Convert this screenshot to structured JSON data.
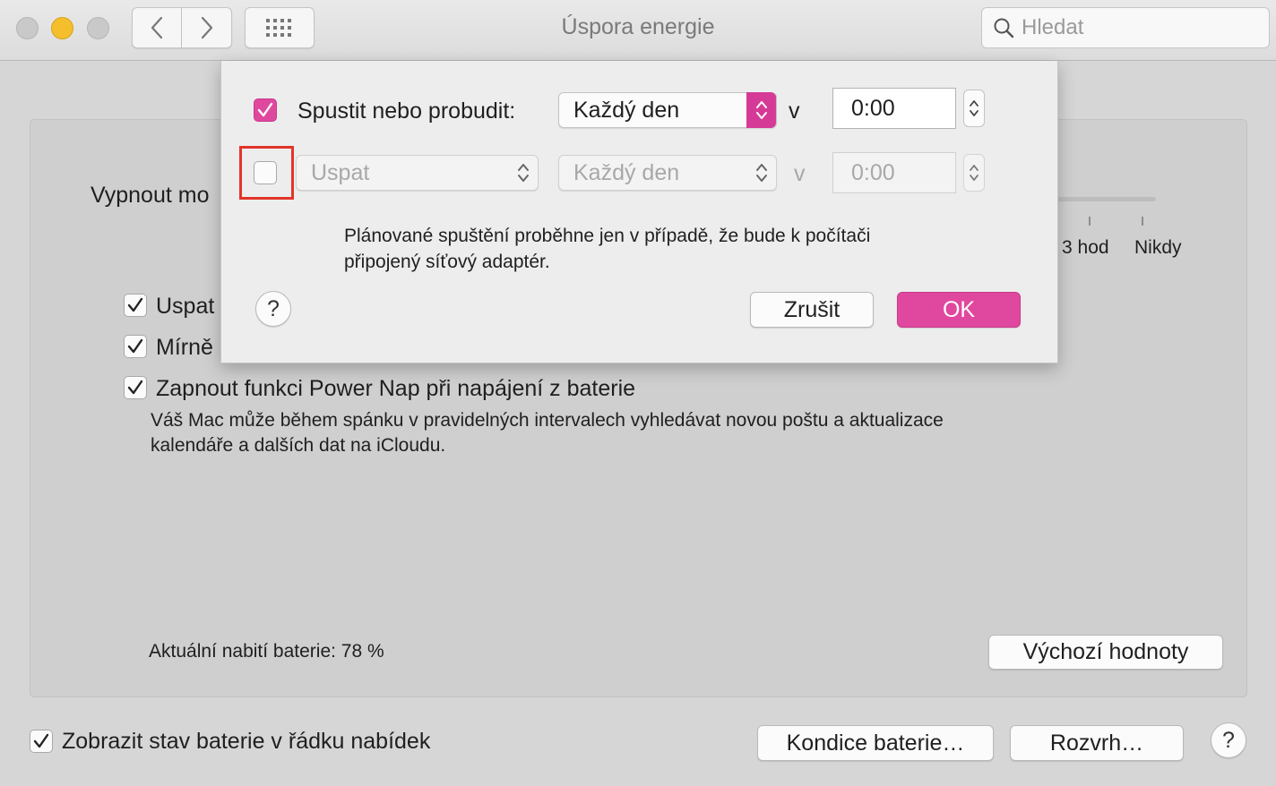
{
  "window": {
    "title": "Úspora energie",
    "search_placeholder": "Hledat"
  },
  "panel": {
    "display_off_label": "Vypnout mo",
    "slider_labels": [
      "3 hod",
      "Nikdy"
    ],
    "checkboxes": [
      {
        "label": "Uspat",
        "checked": true
      },
      {
        "label": "Mírně",
        "checked": true
      },
      {
        "label": "Zapnout funkci Power Nap při napájení z baterie",
        "checked": true
      }
    ],
    "power_nap_description_line1": "Váš Mac může během spánku v pravidelných intervalech vyhledávat novou poštu a aktualizace",
    "power_nap_description_line2": "kalendáře a dalších dat na iCloudu.",
    "battery_charge": "Aktuální nabití baterie: 78 %",
    "defaults_button": "Výchozí hodnoty"
  },
  "footer": {
    "show_battery_label": "Zobrazit stav baterie v řádku nabídek",
    "show_battery_checked": true,
    "battery_health_button": "Kondice baterie…",
    "schedule_button": "Rozvrh…",
    "help": "?"
  },
  "sheet": {
    "row1": {
      "checked": true,
      "label": "Spustit nebo probudit:",
      "frequency": "Každý den",
      "at": "v",
      "time": "0:00"
    },
    "row2": {
      "checked": false,
      "action": "Uspat",
      "frequency": "Každý den",
      "at": "v",
      "time": "0:00"
    },
    "note_line1": "Plánované spuštění proběhne jen v případě, že bude k počítači",
    "note_line2": "připojený síťový adaptér.",
    "help": "?",
    "cancel_button": "Zrušit",
    "ok_button": "OK"
  },
  "colors": {
    "accent": "#e0489f",
    "highlight": "#e2342a"
  }
}
